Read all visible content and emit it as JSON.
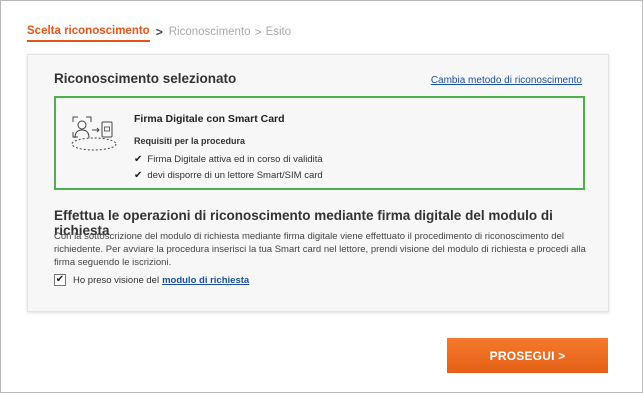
{
  "breadcrumb": {
    "step1": "Scelta riconoscimento",
    "step2": "Riconoscimento",
    "step3": "Esito",
    "separator": ">"
  },
  "card": {
    "title": "Riconoscimento selezionato",
    "change_method_link": "Cambia metodo di riconoscimento",
    "method": {
      "icon": "smartcard-identity-icon",
      "name": "Firma Digitale con Smart Card",
      "requirements_title": "Requisiti per la procedura",
      "requirements": [
        "Firma Digitale attiva ed in corso di validità",
        "devi disporre di un lettore Smart/SIM card"
      ]
    },
    "section_title": "Effettua le operazioni di riconoscimento mediante firma digitale del modulo di richiesta",
    "section_text": "Con la sottoscrizione del modulo di richiesta mediante firma digitale viene effettuato il procedimento di riconoscimento del richiedente. Per avviare la procedura inserisci la tua Smart card nel lettore, prendi visione del modulo di richiesta e procedi alla firma seguendo le iscrizioni.",
    "consent": {
      "checked": true,
      "label": "Ho preso visione del",
      "link": "modulo di richiesta"
    }
  },
  "proceed_button": "PROSEGUI >",
  "colors": {
    "accent": "#e5531a",
    "link": "#1a4fa3",
    "selected_border": "#4caf50",
    "button": "#f06a22"
  }
}
